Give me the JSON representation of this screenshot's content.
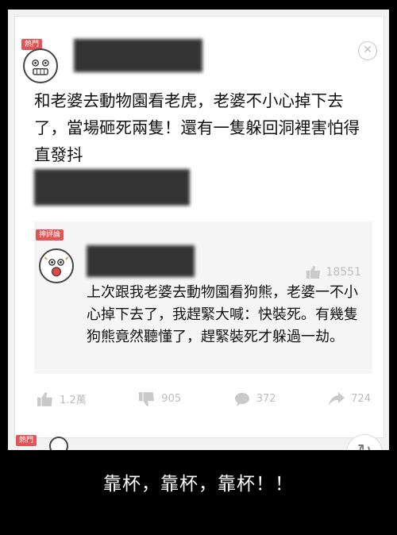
{
  "post": {
    "badge": "熱門",
    "text": "和老婆去動物園看老虎，老婆不小心掉下去了，當場砸死兩隻！還有一隻躲回洞裡害怕得直發抖",
    "close_icon": "close-icon"
  },
  "reply": {
    "badge": "神評論",
    "like_count": "18551",
    "text": "上次跟我老婆去動物園看狗熊，老婆一不小心掉下去了，我趕緊大喊：快裝死。有幾隻狗熊竟然聽懂了，趕緊裝死才躲過一劫。"
  },
  "actions": {
    "like": "1.2萬",
    "dislike": "905",
    "comment": "372",
    "share": "724"
  },
  "next_post": {
    "badge": "熱門"
  },
  "caption": "靠杯，靠杯，靠杯！！",
  "colors": {
    "badge_red": "#e05656",
    "icon_gray": "#c9c9c9"
  }
}
